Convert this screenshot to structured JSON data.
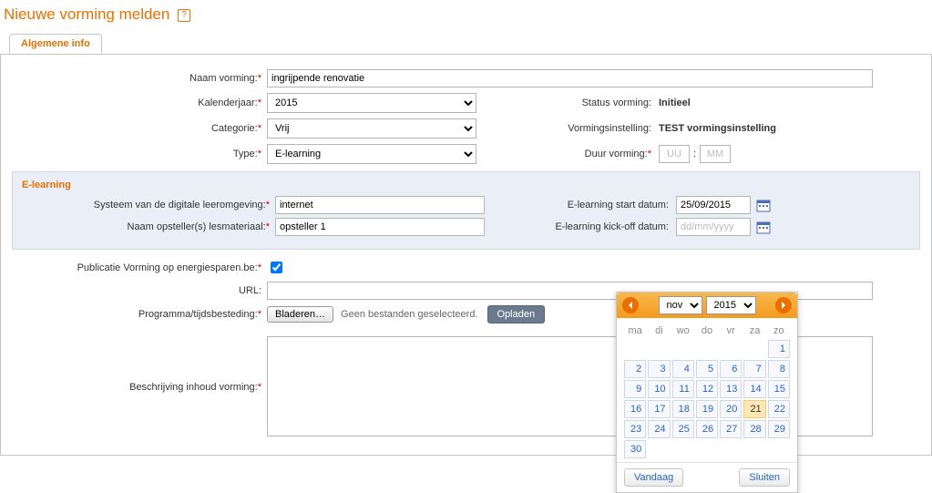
{
  "page": {
    "title": "Nieuwe vorming melden",
    "tab_label": "Algemene info"
  },
  "labels": {
    "naam_vorming": "Naam vorming:",
    "kalenderjaar": "Kalenderjaar:",
    "categorie": "Categorie:",
    "type": "Type:",
    "status_vorming": "Status vorming:",
    "vormingsinstelling": "Vormingsinstelling:",
    "duur_vorming": "Duur vorming:",
    "el_section": "E-learning",
    "systeem_digitale": "Systeem van de digitale leeromgeving:",
    "naam_opsteller": "Naam opsteller(s) lesmateriaal:",
    "el_start": "E-learning start datum:",
    "el_kickoff": "E-learning kick-off datum:",
    "publicatie": "Publicatie Vorming op energiesparen.be:",
    "url": "URL:",
    "programma": "Programma/tijdsbesteding:",
    "beschrijving": "Beschrijving inhoud vorming:",
    "bladeren": "Bladeren…",
    "geen_bestanden": "Geen bestanden geselecteerd.",
    "opladen": "Opladen"
  },
  "values": {
    "naam_vorming": "ingrijpende renovatie",
    "kalenderjaar": "2015",
    "categorie": "Vrij",
    "type": "E-learning",
    "status_vorming": "Initieel",
    "vormingsinstelling": "TEST vormingsinstelling",
    "duur_uu_placeholder": "UU",
    "duur_mm_placeholder": "MM",
    "duur_sep": ":",
    "systeem_digitale": "internet",
    "naam_opsteller": "opsteller 1",
    "el_start": "25/09/2015",
    "el_kickoff_placeholder": "dd/mm/yyyy",
    "publicatie_checked": true,
    "url": "",
    "beschrijving": ""
  },
  "datepicker": {
    "month": "nov",
    "year": "2015",
    "weekdays": [
      "ma",
      "di",
      "wo",
      "do",
      "vr",
      "za",
      "zo"
    ],
    "weeks": [
      [
        null,
        null,
        null,
        null,
        null,
        null,
        1
      ],
      [
        2,
        3,
        4,
        5,
        6,
        7,
        8
      ],
      [
        9,
        10,
        11,
        12,
        13,
        14,
        15
      ],
      [
        16,
        17,
        18,
        19,
        20,
        21,
        22
      ],
      [
        23,
        24,
        25,
        26,
        27,
        28,
        29
      ],
      [
        30,
        null,
        null,
        null,
        null,
        null,
        null
      ]
    ],
    "today": 21,
    "btn_today": "Vandaag",
    "btn_close": "Sluiten"
  }
}
